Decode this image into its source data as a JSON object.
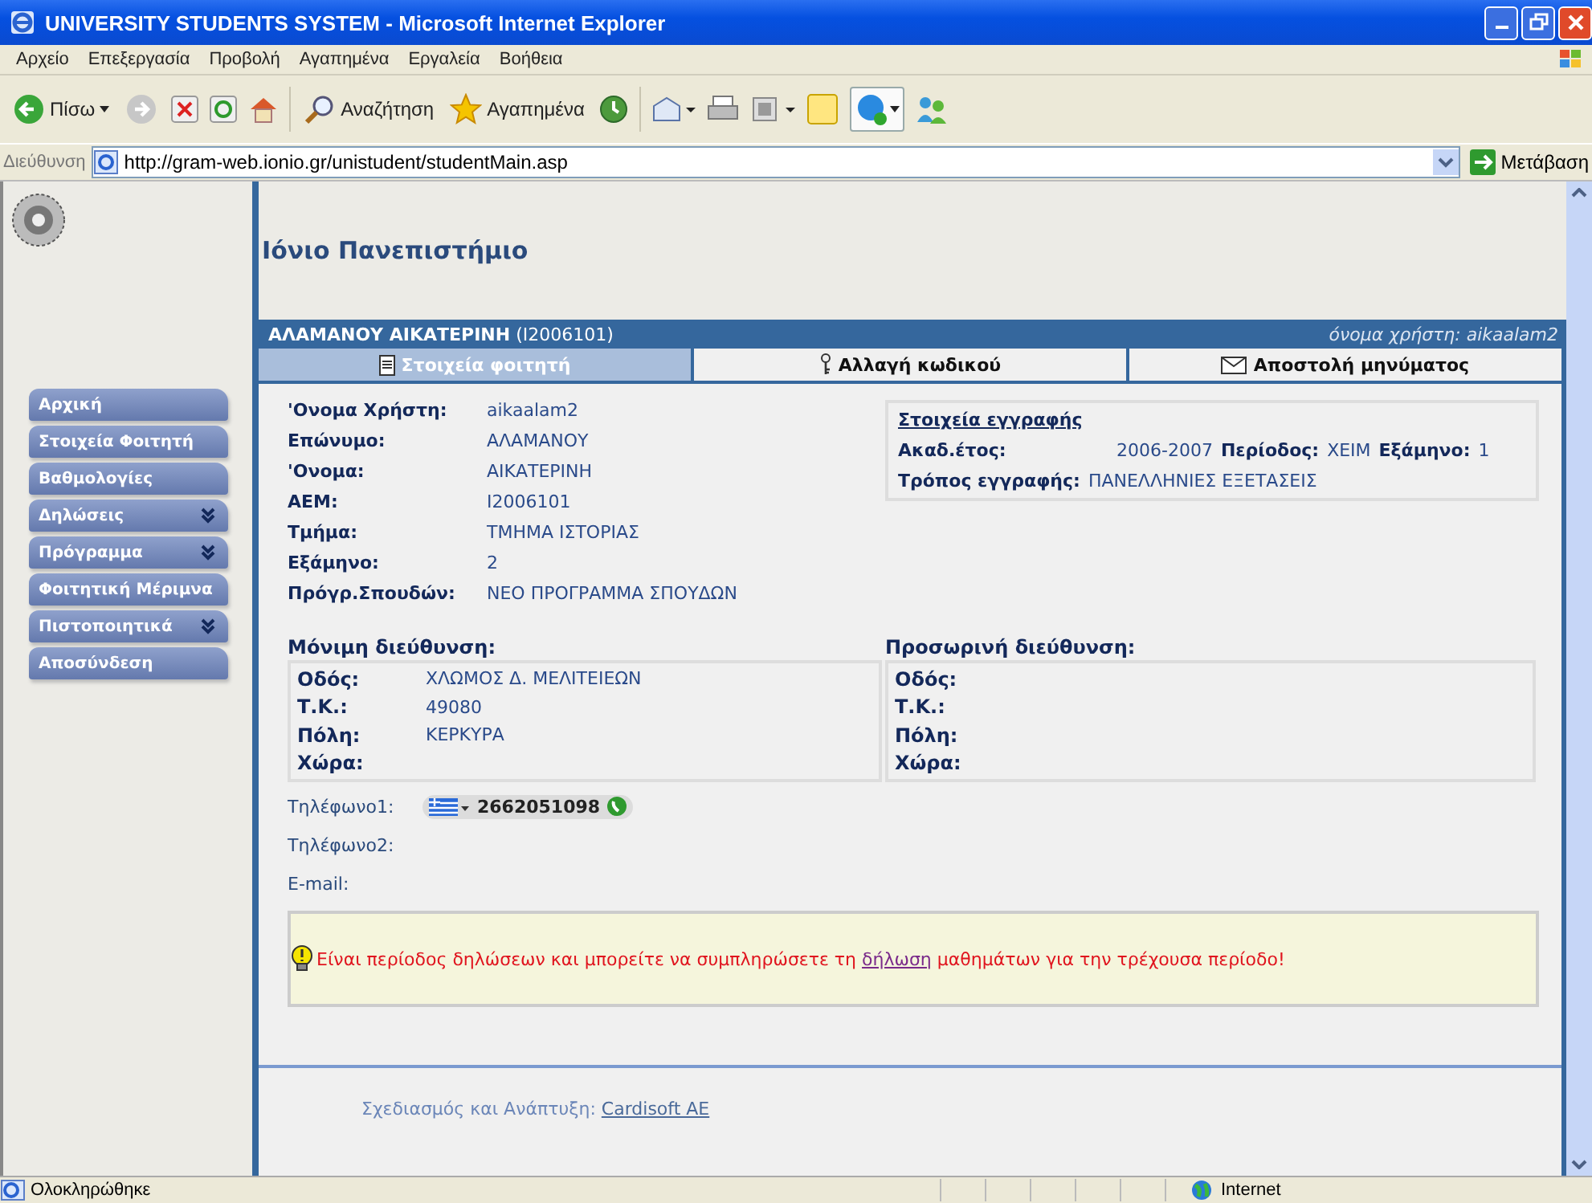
{
  "window": {
    "title": "UNIVERSITY STUDENTS SYSTEM - Microsoft Internet Explorer"
  },
  "menu_bar": [
    "Αρχείο",
    "Επεξεργασία",
    "Προβολή",
    "Αγαπημένα",
    "Εργαλεία",
    "Βοήθεια"
  ],
  "toolbar": {
    "back_label": "Πίσω",
    "search_label": "Αναζήτηση",
    "favorites_label": "Αγαπημένα"
  },
  "address_bar": {
    "label": "Διεύθυνση",
    "url": "http://gram-web.ionio.gr/unistudent/studentMain.asp",
    "go_label": "Μετάβαση"
  },
  "sidebar": {
    "items": [
      {
        "label": "Αρχική",
        "expandable": false
      },
      {
        "label": "Στοιχεία Φοιτητή",
        "expandable": false
      },
      {
        "label": "Βαθμολογίες",
        "expandable": false
      },
      {
        "label": "Δηλώσεις",
        "expandable": true
      },
      {
        "label": "Πρόγραμμα",
        "expandable": true
      },
      {
        "label": "Φοιτητική Μέριμνα",
        "expandable": false
      },
      {
        "label": "Πιστοποιητικά",
        "expandable": true
      },
      {
        "label": "Αποσύνδεση",
        "expandable": false
      }
    ]
  },
  "site_title": "Ιόνιο Πανεπιστήμιο",
  "student_bar": {
    "name": "**ΑΛΑΜΑΝΟΥ ΑΙΚΑΤΕΡΙΝΗ** (I2006101)",
    "username": "όνομα χρήστη: aikaalam2"
  },
  "tabs": [
    {
      "label": "Στοιχεία φοιτητή",
      "selected": true
    },
    {
      "label": "Αλλαγή κωδικού",
      "selected": false
    },
    {
      "label": "Αποστολή μηνύματος",
      "selected": false
    }
  ],
  "profile": [
    {
      "label": "'Ονομα Χρήστη:",
      "value": "aikaalam2"
    },
    {
      "label": "Επώνυμο:",
      "value": "ΑΛΑΜΑΝΟΥ"
    },
    {
      "label": "'Ονομα:",
      "value": "ΑΙΚΑΤΕΡΙΝΗ"
    },
    {
      "label": "ΑΕΜ:",
      "value": "I2006101"
    },
    {
      "label": "Τμήμα:",
      "value": "ΤΜΗΜΑ ΙΣΤΟΡΙΑΣ"
    },
    {
      "label": "Εξάμηνο:",
      "value": "2"
    },
    {
      "label": "Πρόγρ.Σπουδών:",
      "value": "ΝΕΟ ΠΡΟΓΡΑΜΜΑ ΣΠΟΥΔΩΝ"
    }
  ],
  "registration": {
    "title": "Στοιχεία εγγραφής",
    "year_label": "Ακαδ.έτος:",
    "year": "2006-2007",
    "period_label": "Περίοδος:",
    "period": "ΧΕΙΜ",
    "semester_label": "Εξάμηνο:",
    "semester": "1",
    "mode_label": "Τρόπος εγγραφής:",
    "mode": "ΠΑΝΕΛΛΗΝΙΕΣ ΕΞΕΤΑΣΕΙΣ"
  },
  "addresses": [
    {
      "title": "Μόνιμη διεύθυνση:",
      "rows": [
        {
          "label": "Οδός:",
          "value": "ΧΛΩΜΟΣ Δ. ΜΕΛΙΤΕΙΕΩΝ"
        },
        {
          "label": "Τ.Κ.:",
          "value": "49080"
        },
        {
          "label": "Πόλη:",
          "value": "ΚΕΡΚΥΡΑ"
        },
        {
          "label": "Χώρα:"
        }
      ]
    },
    {
      "title": "Προσωρινή διεύθυνση:",
      "rows": [
        {
          "label": "Οδός:"
        },
        {
          "label": "Τ.Κ.:"
        },
        {
          "label": "Πόλη:"
        },
        {
          "label": "Χώρα:"
        }
      ]
    }
  ],
  "contacts": [
    {
      "label": "Τηλέφωνο1:",
      "value": "2662051098"
    },
    {
      "label": "Τηλέφωνο2:"
    },
    {
      "label": "E-mail:"
    }
  ],
  "notice": {
    "before": "Είναι περίοδος δηλώσεων και μπορείτε να συμπληρώσετε τη",
    "link": "δήλωση",
    "after": "μαθημάτων για την τρέχουσα περίοδο!"
  },
  "footer": {
    "label": "Σχεδιασμός και Ανάπτυξη:",
    "link": "Cardisoft AE"
  },
  "status_bar": {
    "text": "Ολοκληρώθηκε",
    "zone": "Internet"
  }
}
